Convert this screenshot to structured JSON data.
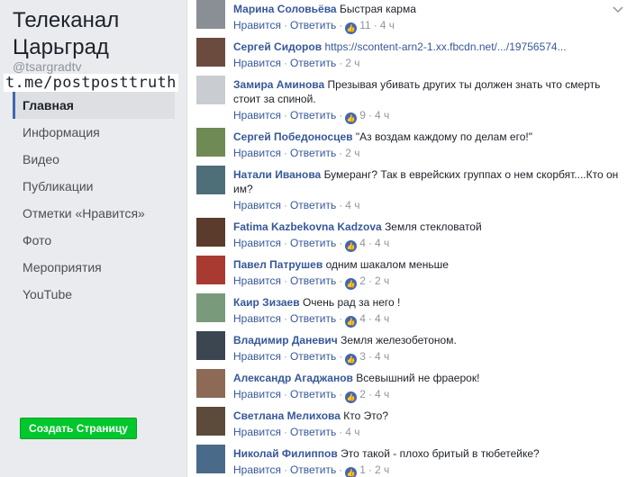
{
  "sidebar": {
    "title": "Телеканал Царьград",
    "handle": "@tsargradtv",
    "watermark": "t.me/postposttruth",
    "nav": [
      {
        "label": "Главная",
        "active": true
      },
      {
        "label": "Информация",
        "active": false
      },
      {
        "label": "Видео",
        "active": false
      },
      {
        "label": "Публикации",
        "active": false
      },
      {
        "label": "Отметки «Нравится»",
        "active": false
      },
      {
        "label": "Фото",
        "active": false
      },
      {
        "label": "Мероприятия",
        "active": false
      },
      {
        "label": "YouTube",
        "active": false
      }
    ],
    "create_button": "Создать Страницу"
  },
  "actions": {
    "like": "Нравится",
    "reply": "Ответить"
  },
  "comments": [
    {
      "author": "Марина Соловьёва",
      "text": "Быстрая карма",
      "likes": "11",
      "time": "4 ч",
      "avatar_color": "#8a8f96"
    },
    {
      "author": "Сергей Сидоров",
      "text": "https://scontent-arn2-1.xx.fbcdn.net/.../19756574...",
      "is_link": true,
      "likes": "",
      "time": "2 ч",
      "avatar_color": "#6b4b3e"
    },
    {
      "author": "Замира Аминова",
      "text": "Презывая убивать других ты должен знать что смерть стоит за спиной.",
      "likes": "9",
      "time": "4 ч",
      "avatar_color": "#c9ccd1"
    },
    {
      "author": "Сергей Победоносцев",
      "text": "\"Аз воздам каждому по делам его!\"",
      "likes": "",
      "time": "2 ч",
      "avatar_color": "#6f8a55"
    },
    {
      "author": "Натали Иванова",
      "text": "Бумеранг? Так в еврейских группах о нем скорбят....Кто он им?",
      "likes": "",
      "time": "4 ч",
      "avatar_color": "#4f6f78"
    },
    {
      "author": "Fatima Kazbekovna Kadzova",
      "text": "Земля стекловатой",
      "likes": "4",
      "time": "4 ч",
      "avatar_color": "#5a3b2c"
    },
    {
      "author": "Павел Патрушев",
      "text": "одним шакалом меньше",
      "likes": "2",
      "time": "2 ч",
      "avatar_color": "#a83a32"
    },
    {
      "author": "Каир Зизаев",
      "text": "Очень рад за него !",
      "likes": "4",
      "time": "4 ч",
      "avatar_color": "#7a9a7c"
    },
    {
      "author": "Владимир Даневич",
      "text": "Земля железобетоном.",
      "likes": "3",
      "time": "4 ч",
      "avatar_color": "#3c4650"
    },
    {
      "author": "Александр Агаджанов",
      "text": "Всевышний не фраерок!",
      "likes": "2",
      "time": "4 ч",
      "avatar_color": "#8c6a55"
    },
    {
      "author": "Светлана Мелихова",
      "text": "Кто Это?",
      "likes": "",
      "time": "4 ч",
      "avatar_color": "#5c4a3a"
    },
    {
      "author": "Николай Филиппов",
      "text": "Это такой - плохо бритый в тюбетейке?",
      "likes": "1",
      "time": "2 ч",
      "avatar_color": "#4a6a8a"
    }
  ],
  "colors": {
    "link": "#365899",
    "button": "#00c72b",
    "like": "#4267b2"
  }
}
